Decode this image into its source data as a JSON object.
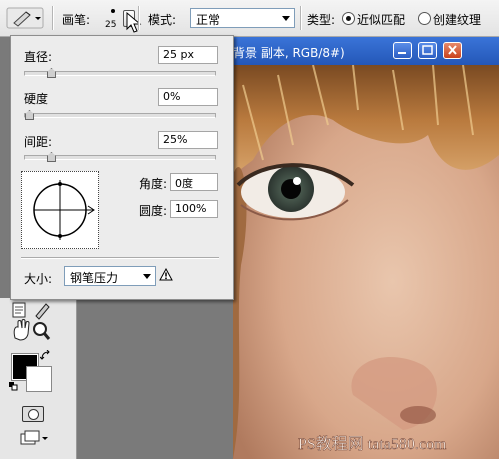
{
  "options_bar": {
    "brush_label": "画笔:",
    "brush_size": "25",
    "mode_label": "模式:",
    "mode_value": "正常",
    "type_label": "类型:",
    "type_option1": "近似匹配",
    "type_option2": "创建纹理",
    "type_selected": "近似匹配"
  },
  "document": {
    "title": "背景 副本, RGB/8#)",
    "watermark": "PS教程网 tata580.com"
  },
  "brush_popup": {
    "diameter_label": "直径:",
    "diameter_value": "25 px",
    "hardness_label": "硬度",
    "hardness_value": "0%",
    "spacing_label": "间距:",
    "spacing_value": "25%",
    "angle_label": "角度:",
    "angle_value": "0度",
    "roundness_label": "圆度:",
    "roundness_value": "100%",
    "size_label": "大小:",
    "size_value": "钢笔压力",
    "diameter_level": 0.12,
    "hardness_level": 0.0,
    "spacing_level": 0.12
  },
  "colors": {
    "foreground": "#000000",
    "background": "#ffffff",
    "titlebar": "#2a5fc4"
  }
}
